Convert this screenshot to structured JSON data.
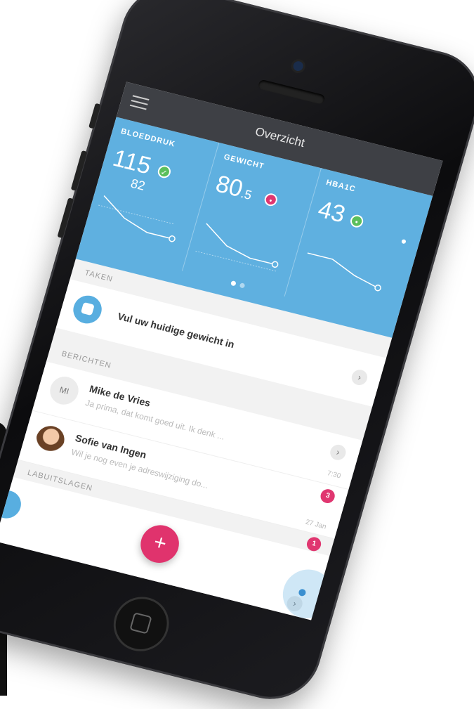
{
  "header": {
    "title": "Overzicht"
  },
  "stats": [
    {
      "label": "BLOEDDRUK",
      "value": "115",
      "subvalue": "82",
      "status": "ok",
      "status_symbol": "✓",
      "trend": [
        0.15,
        0.55,
        0.75,
        0.75
      ]
    },
    {
      "label": "GEWICHT",
      "value": "80",
      "value_decimal": ".5",
      "status": "bad",
      "status_symbol": "•",
      "trend": [
        0.2,
        0.6,
        0.75,
        0.75
      ]
    },
    {
      "label": "HBA1C",
      "value": "43",
      "status": "ok",
      "status_symbol": "•",
      "trend": [
        0.3,
        0.3,
        0.55,
        0.7
      ]
    }
  ],
  "pager": {
    "active": 1,
    "total": 2
  },
  "sections": {
    "tasks": "TAKEN",
    "messages": "BERICHTEN",
    "lab": "LABUITSLAGEN"
  },
  "task": {
    "text": "Vul uw huidige gewicht in"
  },
  "messages": [
    {
      "initials": "MI",
      "name": "Mike de Vries",
      "preview": "Ja prima, dat komt goed uit. Ik denk ...",
      "time": "7:30",
      "badge": "3"
    },
    {
      "initials": "",
      "name": "Sofie van Ingen",
      "preview": "Wil je nog even je adreswijziging do...",
      "time": "27 Jan",
      "badge": "1"
    }
  ],
  "fab": {
    "label": "+"
  },
  "chevron": "›",
  "colors": {
    "accent_blue": "#5fb0e0",
    "accent_pink": "#e0336d",
    "ok_green": "#5bbf5b",
    "topbar": "#3e4045"
  }
}
